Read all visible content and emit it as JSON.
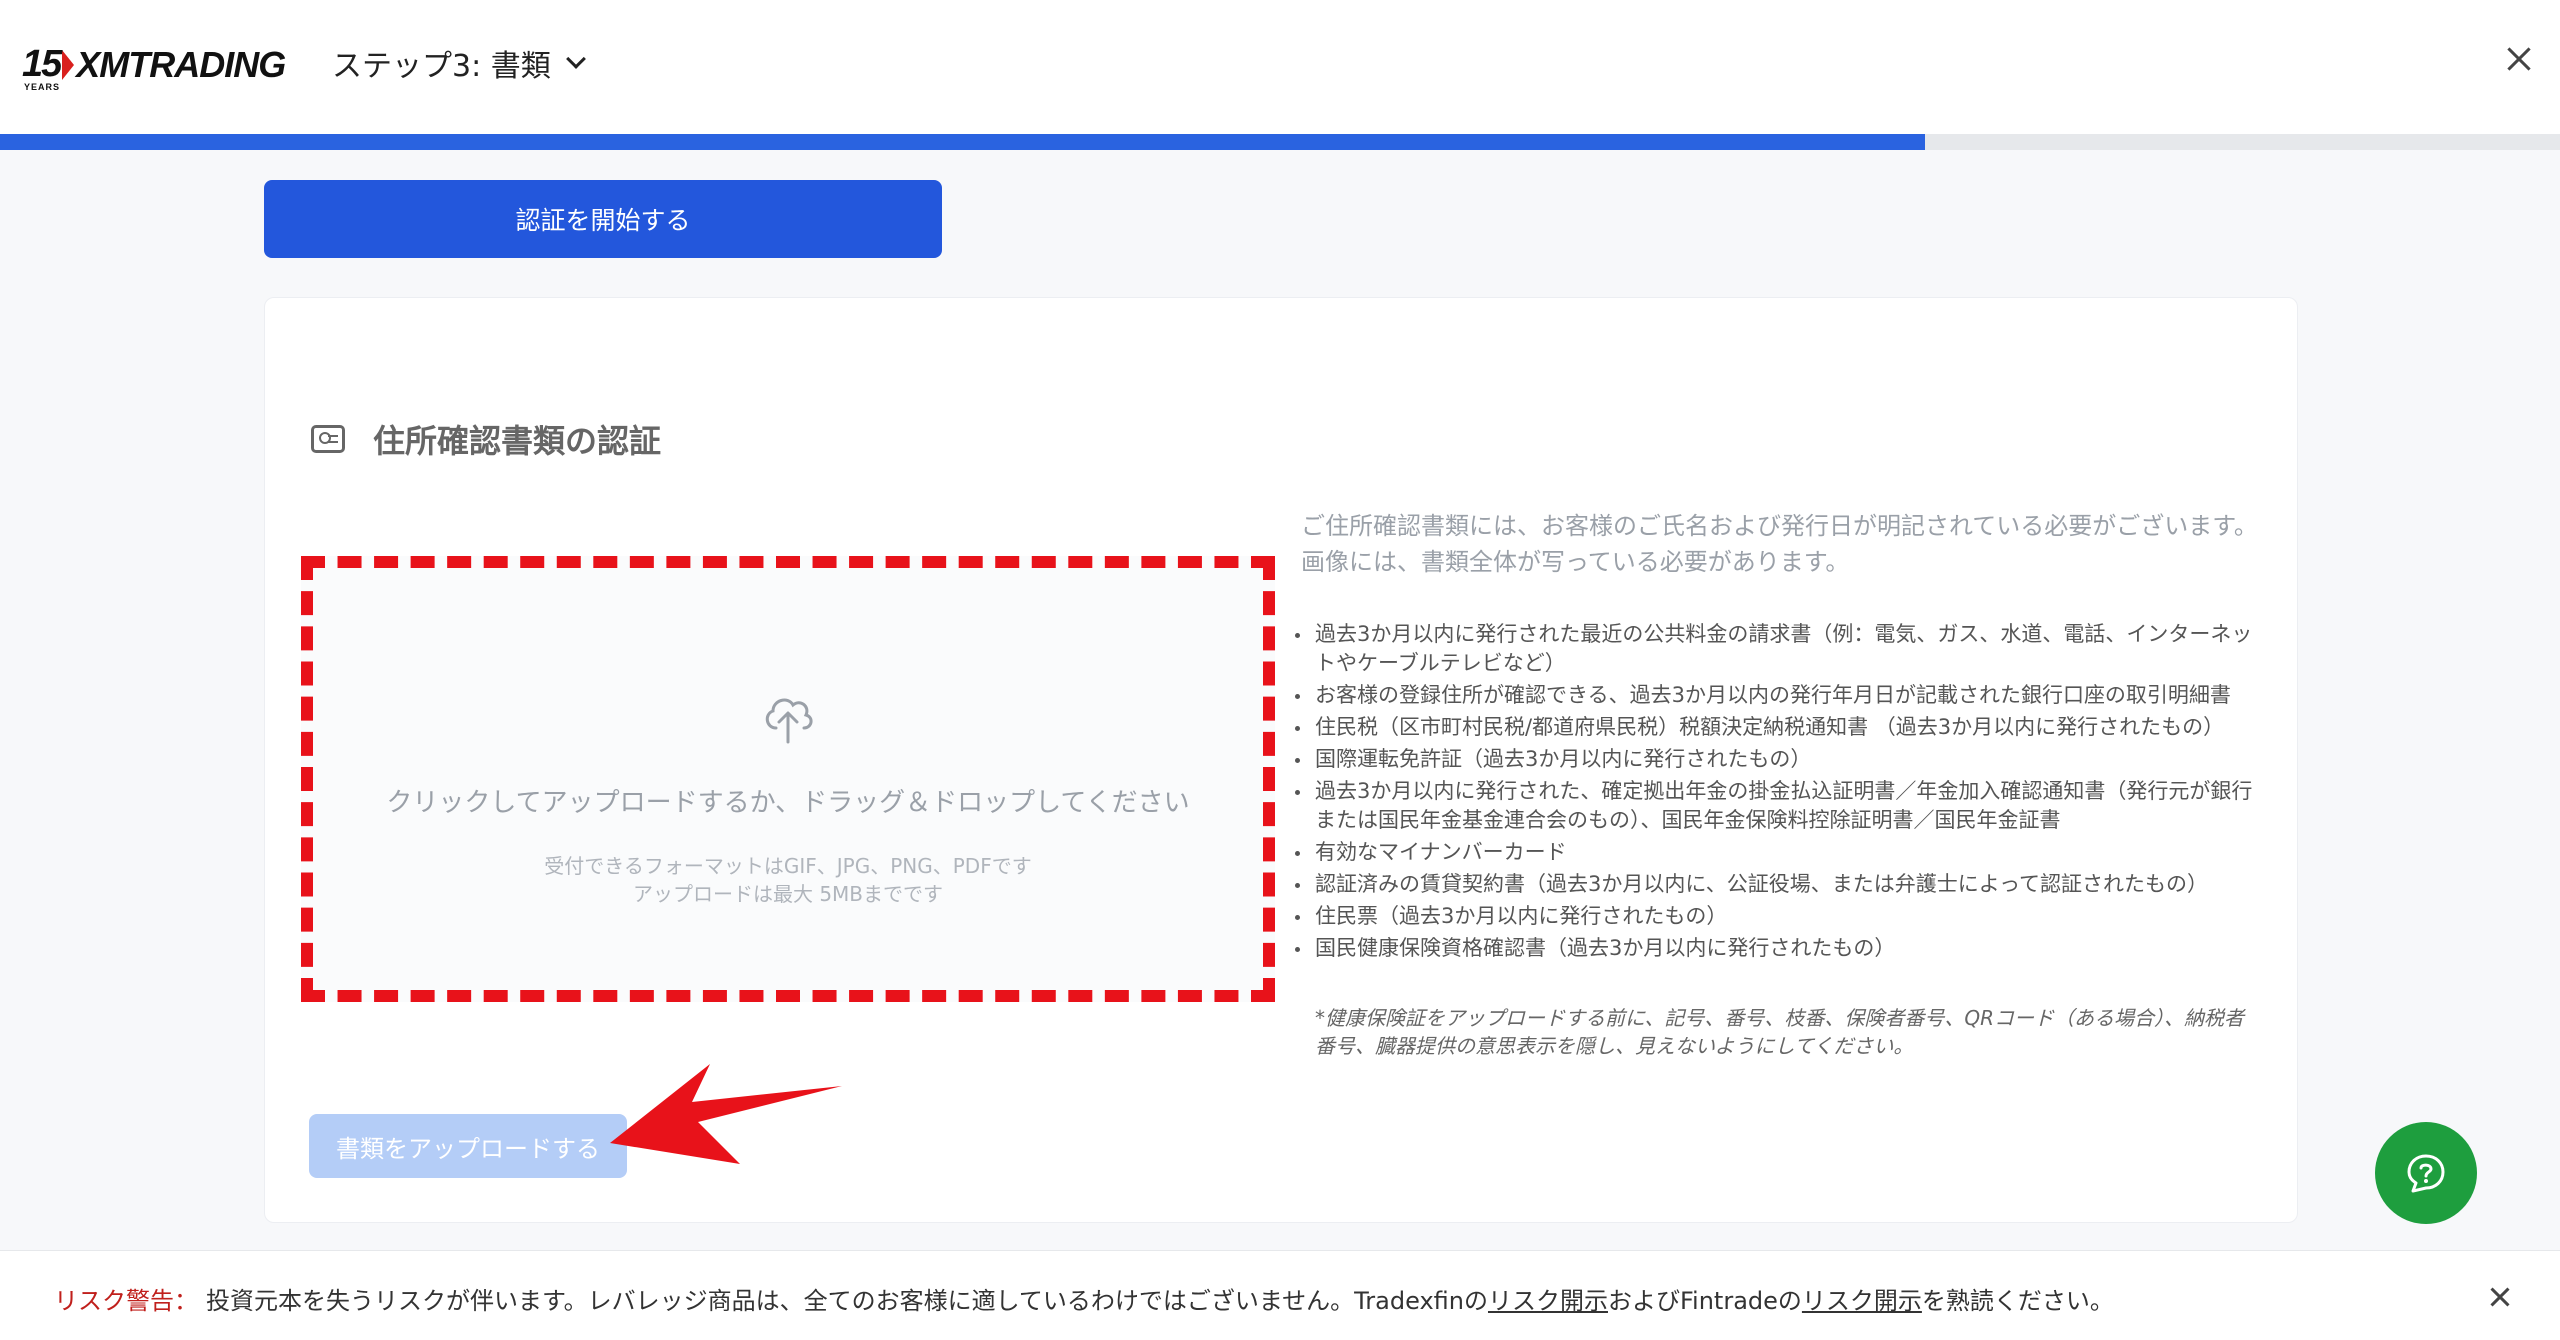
{
  "header": {
    "logo": {
      "number": "15",
      "years": "YEARS",
      "brand": "XMTRADING"
    },
    "step_label": "ステップ3: 書類"
  },
  "progress": {
    "percent": 75.2
  },
  "start_button": "認証を開始する",
  "card": {
    "title": "住所確認書類の認証",
    "dropzone": {
      "main": "クリックしてアップロードするか、ドラッグ＆ドロップしてください",
      "formats": "受付できるフォーマットはGIF、JPG、PNG、PDFです",
      "size": "アップロードは最大 5MBまでです"
    },
    "description": "ご住所確認書類には、お客様のご氏名および発行日が明記されている必要がございます。画像には、書類全体が写っている必要があります。",
    "requirements": [
      "過去3か月以内に発行された最近の公共料金の請求書（例：電気、ガス、水道、電話、インターネットやケーブルテレビなど）",
      "お客様の登録住所が確認できる、過去3か月以内の発行年月日が記載された銀行口座の取引明細書",
      "住民税（区市町村民税/都道府県民税）税額決定納税通知書 （過去3か月以内に発行されたもの）",
      "国際運転免許証（過去3か月以内に発行されたもの）",
      "過去3か月以内に発行された、確定拠出年金の掛金払込証明書／年金加入確認通知書（発行元が銀行または国民年金基金連合会のもの）、国民年金保険料控除証明書／国民年金証書",
      "有効なマイナンバーカード",
      "認証済みの賃貸契約書（過去3か月以内に、公証役場、または弁護士によって認証されたもの）",
      "住民票（過去3か月以内に発行されたもの）",
      "国民健康保険資格確認書（過去3か月以内に発行されたもの）"
    ],
    "note": "*健康保険証をアップロードする前に、記号、番号、枝番、保険者番号、QRコード（ある場合）、納税者番号、臓器提供の意思表示を隠し、見えないようにしてください。",
    "upload_button": "書類をアップロードする"
  },
  "risk": {
    "label": "リスク警告：",
    "text1": "投資元本を失うリスクが伴います。レバレッジ商品は、全てのお客様に適しているわけではございません。Tradexfinの",
    "link1": "リスク開示",
    "text2": "およびFintradeの",
    "link2": "リスク開示",
    "text3": "を熟読ください。"
  },
  "colors": {
    "primary": "#2357dc",
    "progress": "#2a63e0",
    "annotation_red": "#e8121a",
    "chat_green": "#1e9e3e",
    "risk_red": "#c0201c",
    "disabled_button": "#b4cdf7"
  },
  "icons": [
    "close-icon",
    "chevron-down-icon",
    "id-card-icon",
    "cloud-upload-icon",
    "chat-help-icon",
    "annotation-arrow"
  ]
}
